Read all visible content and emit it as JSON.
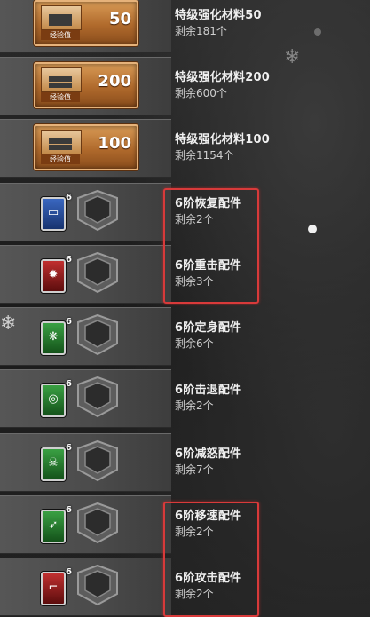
{
  "items": [
    {
      "name": "特级强化材料50",
      "remaining": "剩余181个",
      "box_value": "50",
      "box_tag": "经验值"
    },
    {
      "name": "特级强化材料200",
      "remaining": "剩余600个",
      "box_value": "200",
      "box_tag": "经验值"
    },
    {
      "name": "特级强化材料100",
      "remaining": "剩余1154个",
      "box_value": "100",
      "box_tag": "经验值"
    },
    {
      "name": "6阶恢复配件",
      "remaining": "剩余2个",
      "level": "6",
      "icon": "recovery-icon",
      "badge_color": "#2a4f9a"
    },
    {
      "name": "6阶重击配件",
      "remaining": "剩余3个",
      "level": "6",
      "icon": "heavy-strike-icon",
      "badge_color": "#8c1a1a"
    },
    {
      "name": "6阶定身配件",
      "remaining": "剩余6个",
      "level": "6",
      "icon": "freeze-icon",
      "badge_color": "#237a2c"
    },
    {
      "name": "6阶击退配件",
      "remaining": "剩余2个",
      "level": "6",
      "icon": "knockback-icon",
      "badge_color": "#237a2c"
    },
    {
      "name": "6阶减怒配件",
      "remaining": "剩余7个",
      "level": "6",
      "icon": "rage-reduce-icon",
      "badge_color": "#237a2c"
    },
    {
      "name": "6阶移速配件",
      "remaining": "剩余2个",
      "level": "6",
      "icon": "move-speed-icon",
      "badge_color": "#237a2c"
    },
    {
      "name": "6阶攻击配件",
      "remaining": "剩余2个",
      "level": "6",
      "icon": "attack-icon",
      "badge_color": "#8c1a1a"
    }
  ],
  "highlight_color": "#d83a3a"
}
